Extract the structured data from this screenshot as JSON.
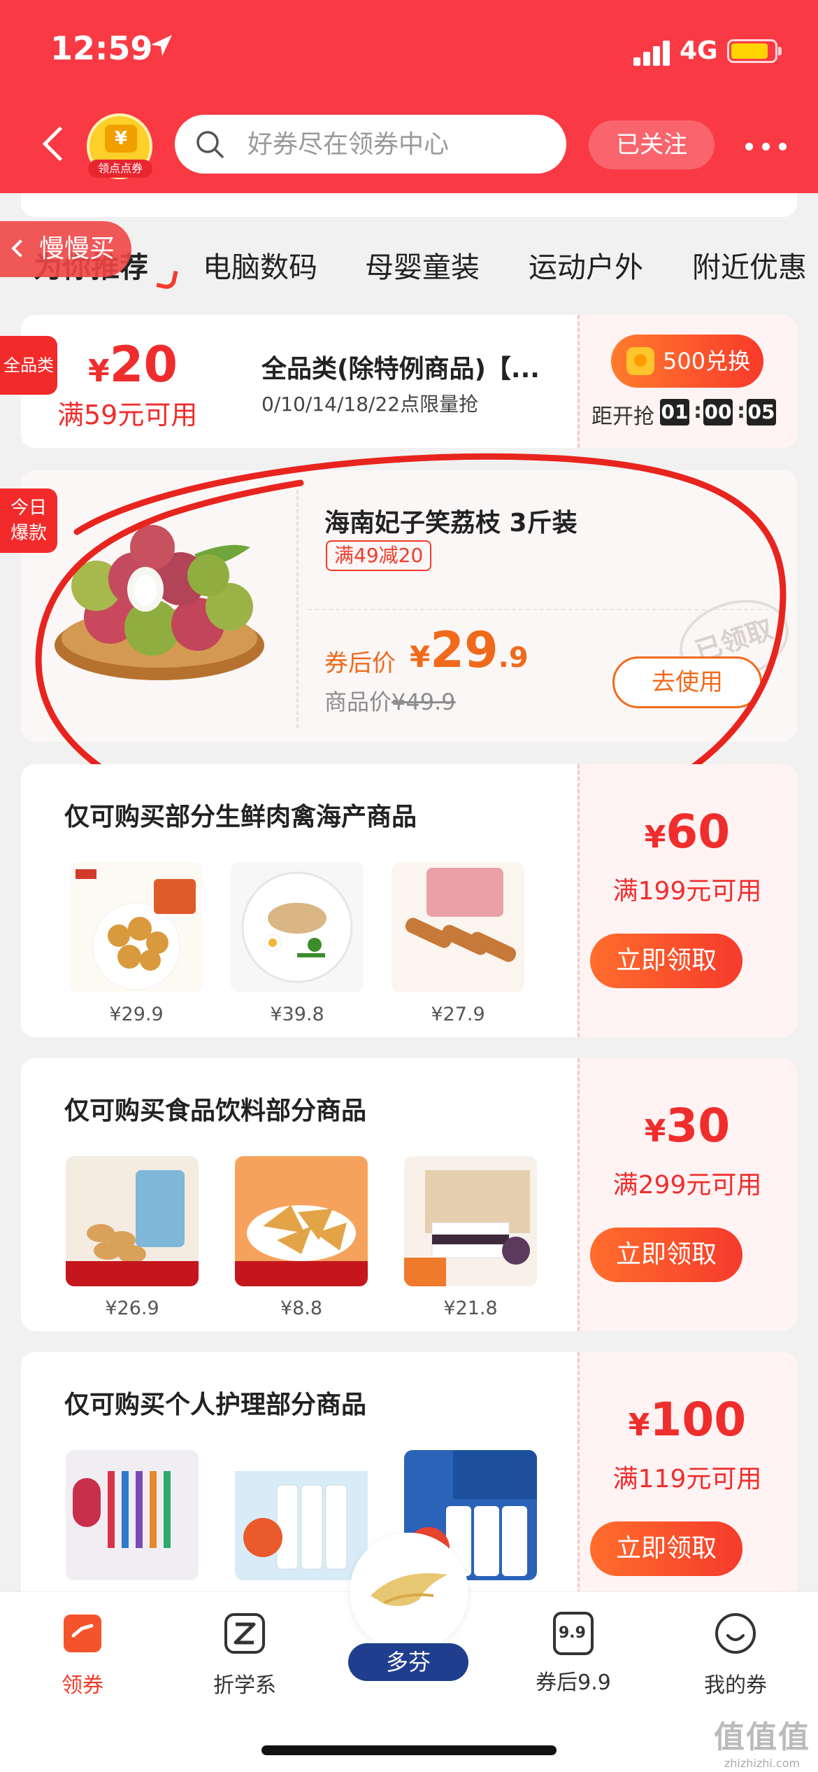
{
  "status_bar": {
    "time": "12:59",
    "network": "4G"
  },
  "header": {
    "shop_logo_label": "领点点券",
    "search_placeholder": "好券尽在领券中心",
    "follow_label": "已关注"
  },
  "categories": {
    "items": [
      {
        "label": "为你推荐",
        "active": true
      },
      {
        "label": "电脑数码"
      },
      {
        "label": "母婴童装"
      },
      {
        "label": "运动户外"
      },
      {
        "label": "附近优惠"
      }
    ],
    "slow_buy_label": "慢慢买"
  },
  "coupon_all": {
    "badge": "全品类",
    "currency": "¥",
    "amount": "20",
    "condition": "满59元可用",
    "title": "全品类(除特例商品)【...",
    "subtitle": "0/10/14/18/22点限量抢",
    "exchange_label": "500兑换",
    "countdown_label": "距开抢",
    "countdown": [
      "01",
      "00",
      "05"
    ]
  },
  "featured": {
    "badge_line1": "今日",
    "badge_line2": "爆款",
    "title": "海南妃子笑荔枝 3斤装",
    "tag": "满49减20",
    "price_label": "券后价",
    "currency": "¥",
    "price_int": "29",
    "price_dec": ".9",
    "orig_label": "商品价",
    "orig_price": "¥49.9",
    "use_label": "去使用",
    "stamp": "已领取"
  },
  "product_coupons": [
    {
      "title": "仅可购买部分生鲜肉禽海产商品",
      "currency": "¥",
      "amount": "60",
      "condition": "满199元可用",
      "claim_label": "立即领取",
      "products": [
        {
          "price": "¥29.9"
        },
        {
          "price": "¥39.8"
        },
        {
          "price": "¥27.9"
        }
      ]
    },
    {
      "title": "仅可购买食品饮料部分商品",
      "currency": "¥",
      "amount": "30",
      "condition": "满299元可用",
      "claim_label": "立即领取",
      "products": [
        {
          "price": "¥26.9"
        },
        {
          "price": "¥8.8"
        },
        {
          "price": "¥21.8"
        }
      ]
    },
    {
      "title": "仅可购买个人护理部分商品",
      "currency": "¥",
      "amount": "100",
      "condition": "满119元可用",
      "claim_label": "立即领取",
      "products": [
        {
          "price": ""
        },
        {
          "price": ""
        },
        {
          "price": ""
        }
      ]
    }
  ],
  "bottom_nav": {
    "items": [
      {
        "label": "领券",
        "icon": "coupon-icon",
        "active": true
      },
      {
        "label": "折学系",
        "icon": "z-icon"
      },
      {
        "label": "多芬",
        "icon": "dove-icon"
      },
      {
        "label": "券后9.9",
        "icon": "nine-nine-icon",
        "badge": "9.9"
      },
      {
        "label": "我的券",
        "icon": "smile-icon"
      }
    ]
  },
  "watermark": {
    "big": "值值值",
    "small": "zhizhizhi.com"
  },
  "colors": {
    "primary": "#f93a45",
    "accent": "#f02d2d",
    "orange": "#f06a1c"
  }
}
